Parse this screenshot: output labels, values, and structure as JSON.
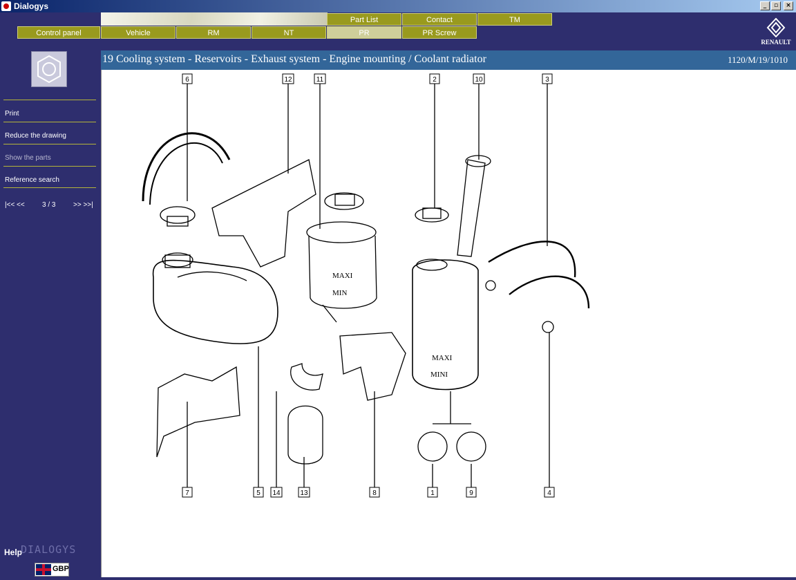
{
  "window": {
    "title": "Dialogys"
  },
  "nav": {
    "top_tabs": [
      {
        "label": "Part List"
      },
      {
        "label": "Contact"
      },
      {
        "label": "TM"
      }
    ],
    "bottom_tabs": [
      {
        "label": "Control panel"
      },
      {
        "label": "Vehicle"
      },
      {
        "label": "RM"
      },
      {
        "label": "NT"
      },
      {
        "label": "PR",
        "active": true
      },
      {
        "label": "PR Screw"
      }
    ]
  },
  "brand": {
    "logo_text": "RENAULT",
    "app_name": "DIALOGYS"
  },
  "sidebar": {
    "items": [
      {
        "label": "Print",
        "enabled": true
      },
      {
        "label": "Reduce the drawing",
        "enabled": true
      },
      {
        "label": "Show the parts",
        "enabled": false
      },
      {
        "label": "Reference search",
        "enabled": true
      }
    ],
    "pager": {
      "first_prev": "|<< <<",
      "page": "3 / 3",
      "next_last": ">> >>|"
    },
    "help_label": "Help",
    "currency": "GBP"
  },
  "header": {
    "title": "19 Cooling system - Reservoirs - Exhaust system - Engine mounting / Coolant radiator",
    "ref": "1120/M/19/1010"
  },
  "drawing": {
    "callouts_top": [
      "6",
      "12",
      "11",
      "2",
      "10",
      "3"
    ],
    "callouts_bottom": [
      "7",
      "5",
      "14",
      "13",
      "8",
      "1",
      "9",
      "4"
    ],
    "labels": {
      "maxi": "MAXI",
      "mini": "MINI",
      "maxi_small": "MAXI",
      "mini_small": "MIN"
    }
  },
  "colors": {
    "nav_bg": "#2e2e6e",
    "tab": "#999a1e",
    "header": "#336699"
  }
}
